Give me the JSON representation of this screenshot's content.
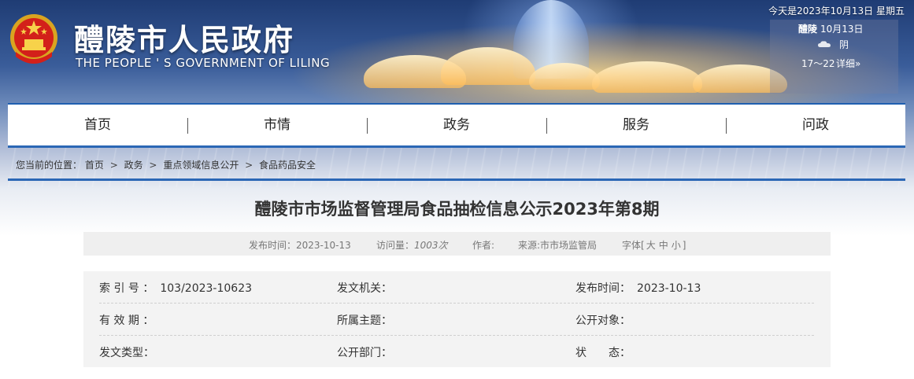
{
  "header": {
    "site_title": "醴陵市人民政府",
    "site_subtitle": "THE PEOPLE ' S GOVERNMENT OF LILING",
    "today": "今天是2023年10月13日 星期五",
    "weather": {
      "city": "醴陵",
      "date": "10月13日",
      "icon": "cloud-icon",
      "condition": "阴",
      "temperature": "17～22",
      "detail_link": "详细»"
    }
  },
  "nav": {
    "items": [
      {
        "label": "首页"
      },
      {
        "label": "市情"
      },
      {
        "label": "政务"
      },
      {
        "label": "服务"
      },
      {
        "label": "问政"
      }
    ]
  },
  "breadcrumb": {
    "prefix": "您当前的位置：",
    "items": [
      "首页",
      "政务",
      "重点领域信息公开",
      "食品药品安全"
    ],
    "separator": ">"
  },
  "article": {
    "title": "醴陵市市场监督管理局食品抽检信息公示2023年第8期",
    "meta": {
      "published": "发布时间：2023-10-13",
      "visits_label": "访问量：",
      "visits_value": "1003次",
      "author": "作者:",
      "source": "来源:市市场监管局",
      "font_label": "字体[",
      "font_large": "大",
      "font_medium": "中",
      "font_small": "小",
      "font_close": "]"
    },
    "info": {
      "index_label": "索 引 号 ：",
      "index_value": "103/2023-10623",
      "issuer_label": "发文机关：",
      "issuer_value": "",
      "date_label": "发布时间：",
      "date_value": "2023-10-13",
      "validity_label": "有 效 期 ：",
      "validity_value": "",
      "topic_label": "所属主题：",
      "topic_value": "",
      "audience_label": "公开对象：",
      "audience_value": "",
      "doc_type_label": "发文类型：",
      "doc_type_value": "",
      "dept_label": "公开部门：",
      "dept_value": "",
      "status_label": "状　　态：",
      "status_value": ""
    }
  },
  "colors": {
    "nav_border": "#2b67b5",
    "title_text": "#333333",
    "meta_bg": "#efefef",
    "info_bg": "#f3f3f3"
  }
}
